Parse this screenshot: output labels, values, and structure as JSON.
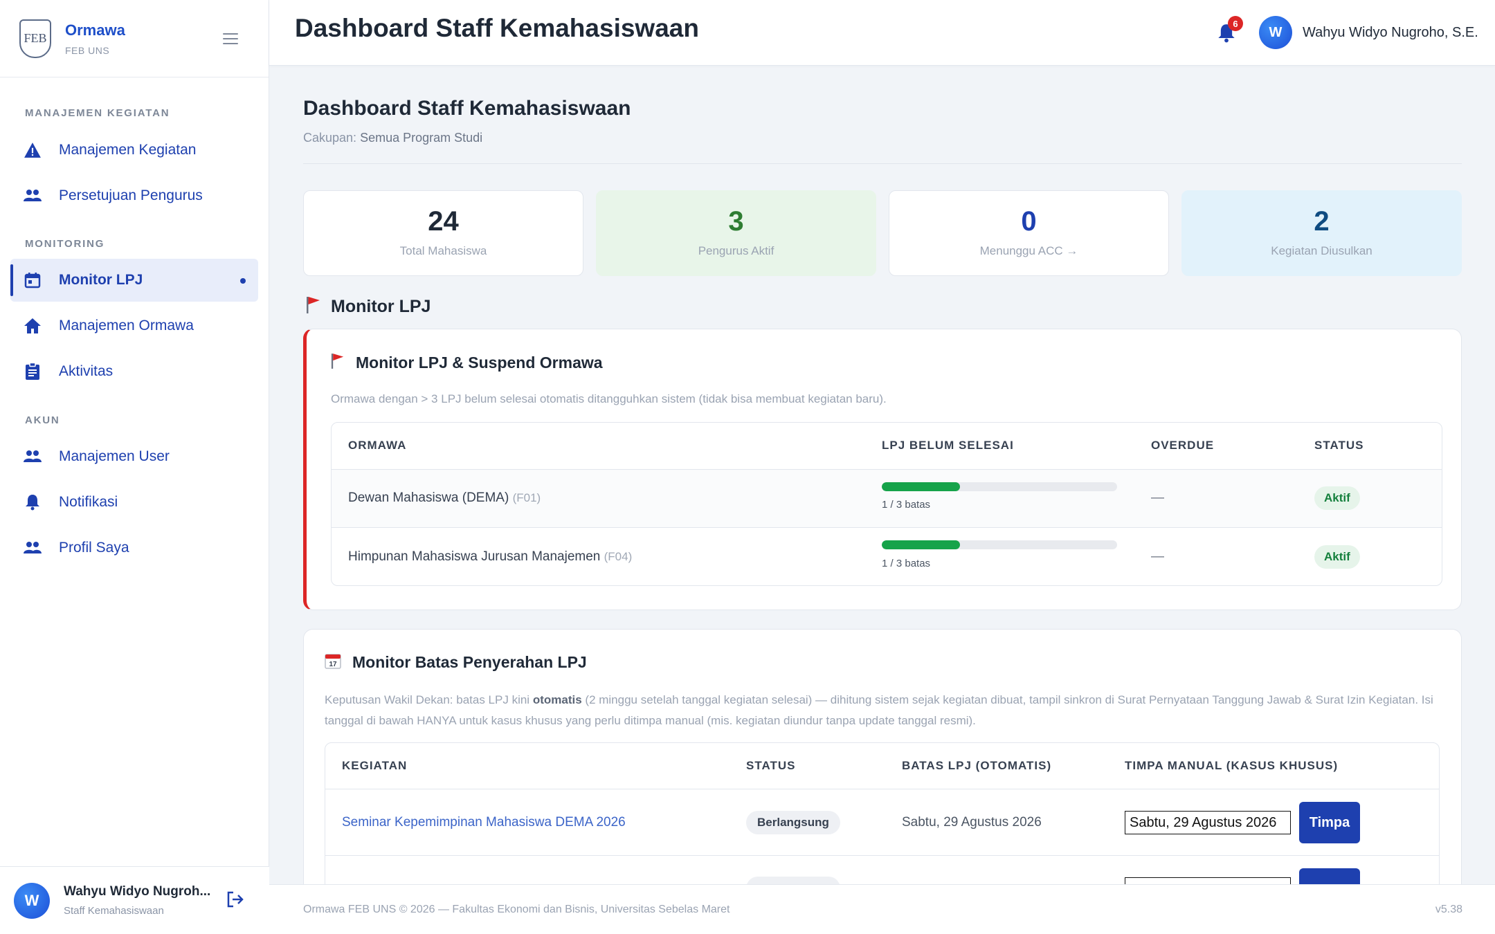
{
  "brand": {
    "name": "Ormawa",
    "sub": "FEB UNS",
    "logo_text": "FEB"
  },
  "sidebar": {
    "sections": [
      {
        "title": "MANAJEMEN KEGIATAN"
      },
      {
        "title": "MONITORING"
      },
      {
        "title": "AKUN"
      }
    ],
    "items": [
      {
        "label": "Manajemen Kegiatan",
        "icon": "warning-icon"
      },
      {
        "label": "Persetujuan Pengurus",
        "icon": "people-icon"
      },
      {
        "label": "Monitor LPJ",
        "icon": "calendar-icon",
        "active": true
      },
      {
        "label": "Manajemen Ormawa",
        "icon": "home-icon"
      },
      {
        "label": "Aktivitas",
        "icon": "clipboard-icon"
      },
      {
        "label": "Manajemen User",
        "icon": "people-icon"
      },
      {
        "label": "Notifikasi",
        "icon": "bell-icon"
      },
      {
        "label": "Profil Saya",
        "icon": "people-icon"
      }
    ],
    "user": {
      "initial": "W",
      "name": "Wahyu Widyo Nugroh...",
      "role": "Staff Kemahasiswaan"
    }
  },
  "topbar": {
    "title": "Dashboard Staff Kemahasiswaan",
    "notif_count": "6",
    "user_initial": "W",
    "user_name": "Wahyu Widyo Nugroho, S.E."
  },
  "page": {
    "title": "Dashboard Staff Kemahasiswaan",
    "scope_label": "Cakupan:",
    "scope_value": "Semua Program Studi"
  },
  "stats": [
    {
      "value": "24",
      "label": "Total Mahasiswa",
      "color": "#1f2937"
    },
    {
      "value": "3",
      "label": "Pengurus Aktif",
      "color": "#2e7d32"
    },
    {
      "value": "0",
      "label": "Menunggu ACC →",
      "color": "#1e40af"
    },
    {
      "value": "2",
      "label": "Kegiatan Diusulkan",
      "color": "#0f4c81"
    }
  ],
  "monitor_section": {
    "title": "Monitor LPJ"
  },
  "lpj_card": {
    "title": "Monitor LPJ & Suspend Ormawa",
    "desc": "Ormawa dengan > 3 LPJ belum selesai otomatis ditangguhkan sistem (tidak bisa membuat kegiatan baru).",
    "headers": [
      "ORMAWA",
      "LPJ BELUM SELESAI",
      "OVERDUE",
      "STATUS"
    ],
    "rows": [
      {
        "name": "Dewan Mahasiswa (DEMA)",
        "code": "(F01)",
        "progress": 0.3333,
        "caption": "1 / 3 batas",
        "overdue": "—",
        "status": "Aktif"
      },
      {
        "name": "Himpunan Mahasiswa Jurusan Manajemen",
        "code": "(F04)",
        "progress": 0.3333,
        "caption": "1 / 3 batas",
        "overdue": "—",
        "status": "Aktif"
      }
    ]
  },
  "deadline_card": {
    "title": "Monitor Batas Penyerahan LPJ",
    "desc_1": "Keputusan Wakil Dekan: batas LPJ kini",
    "desc_bold": "otomatis",
    "desc_2": "(2 minggu setelah tanggal kegiatan selesai) — dihitung sistem sejak kegiatan dibuat, tampil sinkron di Surat Pernyataan Tanggung Jawab & Surat Izin Kegiatan. Isi tanggal di bawah HANYA untuk kasus khusus yang perlu ditimpa manual (mis. kegiatan diundur tanpa update tanggal resmi).",
    "headers": [
      "KEGIATAN",
      "STATUS",
      "BATAS LPJ (OTOMATIS)",
      "TIMPA MANUAL (KASUS KHUSUS)"
    ],
    "rows": [
      {
        "name": "Seminar Kepemimpinan Mahasiswa DEMA 2026",
        "status": "Berlangsung",
        "deadline": "Sabtu, 29 Agustus 2026",
        "override": "Sabtu, 29 Agustus 2026",
        "button": "Timpa"
      }
    ]
  },
  "footer": {
    "left": "Ormawa FEB UNS © 2026 — Fakultas Ekonomi dan Bisnis, Universitas Sebelas Maret",
    "right": "v5.38"
  }
}
